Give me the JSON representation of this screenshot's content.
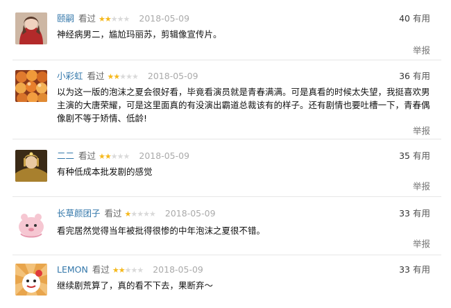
{
  "report_label": "举报",
  "useful_label": "有用",
  "comments": [
    {
      "user": "颐嗣",
      "watched": "看过",
      "rating": 2,
      "date": "2018-05-09",
      "votes": "40",
      "text": "神经病男二，尴尬玛丽苏，剪辑像宣传片。",
      "avatar": "avatar-woman-portrait"
    },
    {
      "user": "小彩虹",
      "watched": "看过",
      "rating": 2,
      "date": "2018-05-09",
      "votes": "36",
      "text": "以为这一版的泡沫之夏会很好看，毕竟看演员就是青春满满。可是真看的时候太失望，我挺喜欢男主演的大唐荣耀，可是这里面真的有没演出霸道总裁该有的样子。还有剧情也要吐槽一下，青春偶像剧不等于矫情、低龄!",
      "avatar": "avatar-fruit"
    },
    {
      "user": "二二",
      "watched": "看过",
      "rating": 2,
      "date": "2018-05-09",
      "votes": "35",
      "text": "有种低成本批发剧的感觉",
      "avatar": "avatar-costume-figure"
    },
    {
      "user": "长草颜团子",
      "watched": "看过",
      "rating": 1,
      "date": "2018-05-09",
      "votes": "33",
      "text": "看完居然觉得当年被批得很惨的中年泡沫之夏很不错。",
      "avatar": "avatar-pink-cartoon"
    },
    {
      "user": "LEMON",
      "watched": "看过",
      "rating": 2,
      "date": "2018-05-09",
      "votes": "33",
      "text": "继续剧荒算了，真的看不下去，果断弃～",
      "avatar": "avatar-cartoon-sunburst"
    }
  ],
  "colors": {
    "link": "#3377aa",
    "star_on": "#f5b81c",
    "star_off": "#d9d9d9",
    "date": "#aaaaaa",
    "separator": "#e6e6e6"
  }
}
